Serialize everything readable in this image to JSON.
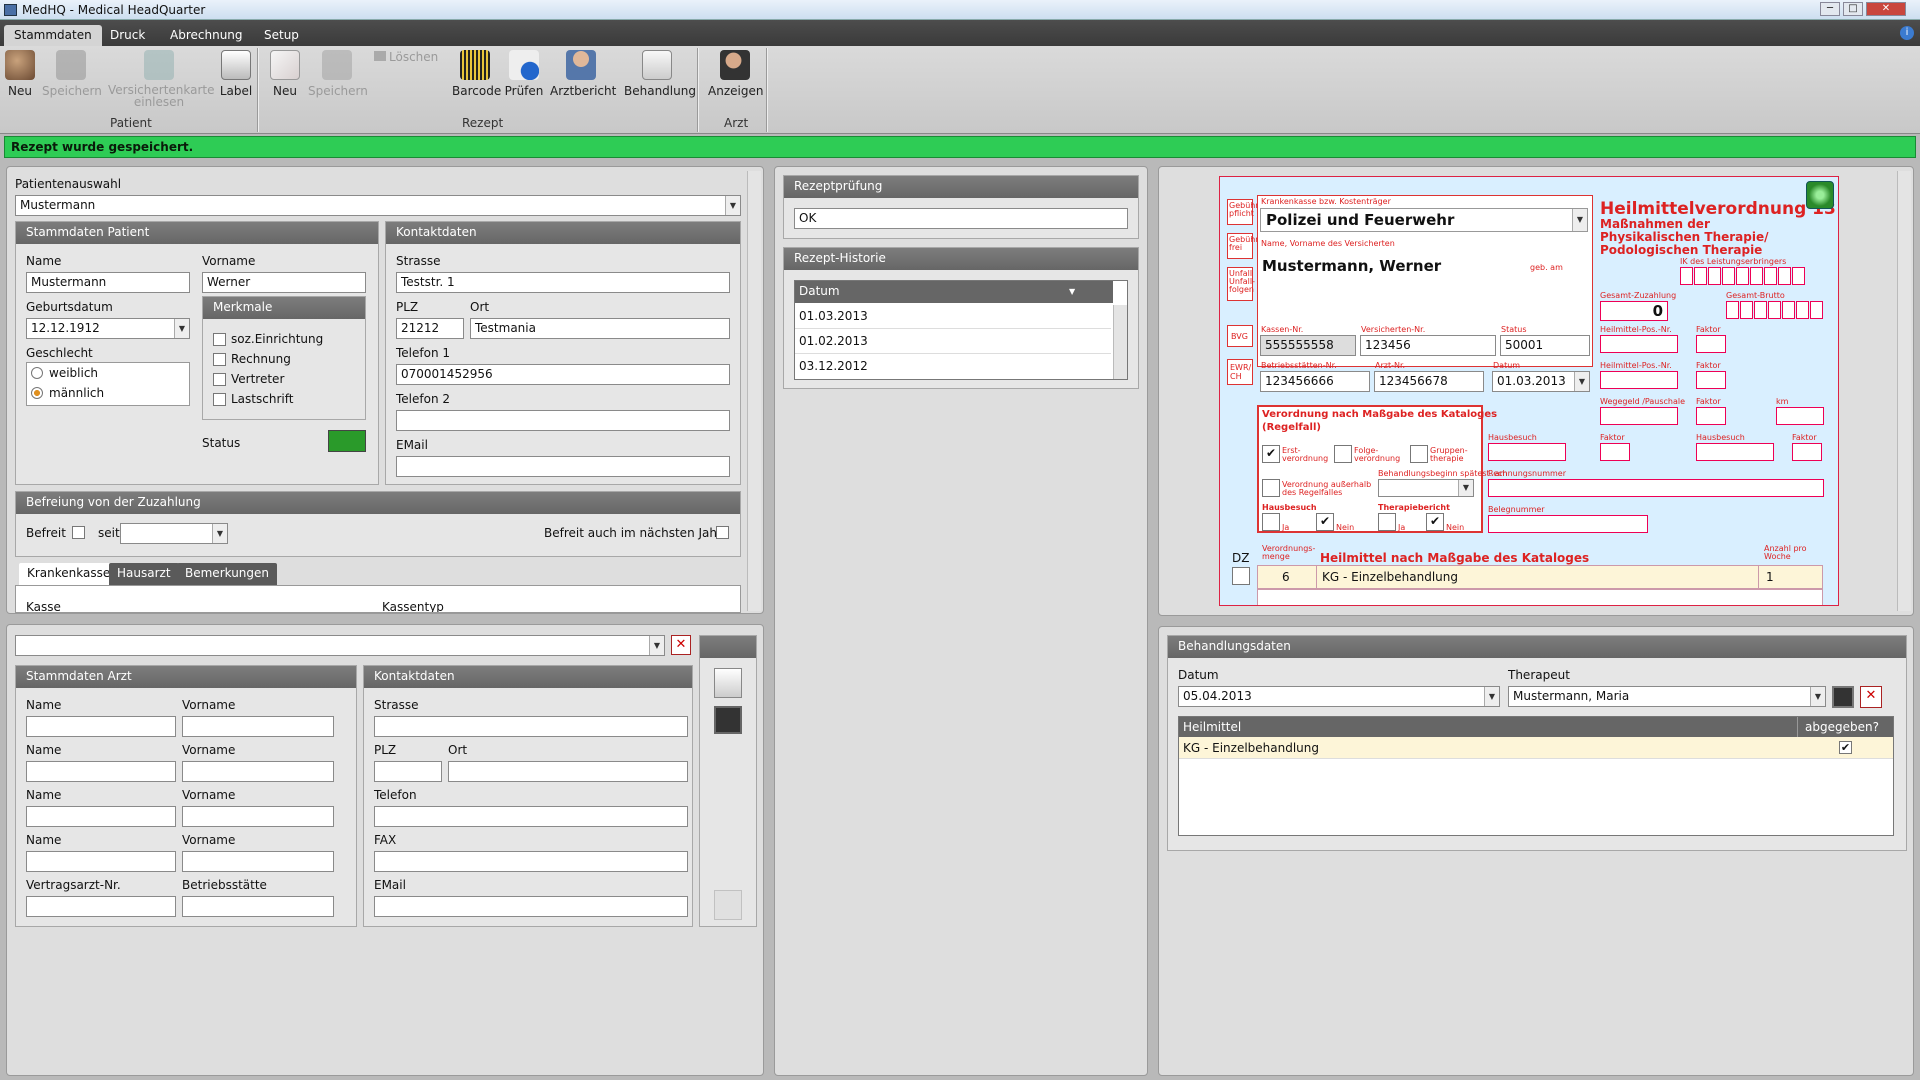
{
  "window": {
    "title": "MedHQ - Medical HeadQuarter",
    "min": "─",
    "max": "□",
    "close": "✕"
  },
  "ribbon": {
    "tabs": [
      "Stammdaten",
      "Druck",
      "Abrechnung",
      "Setup"
    ],
    "patient": {
      "neu": "Neu",
      "speichern": "Speichern",
      "karte": "Versichertenkarte einlesen",
      "label": "Label",
      "group": "Patient"
    },
    "rezept": {
      "neu": "Neu",
      "speichern": "Speichern",
      "loeschen": "Löschen",
      "barcode": "Barcode",
      "pruefen": "Prüfen",
      "arztbericht": "Arztbericht",
      "behandlung": "Behandlung",
      "group": "Rezept"
    },
    "arzt": {
      "anzeigen": "Anzeigen",
      "group": "Arzt"
    }
  },
  "status_message": "Rezept wurde gespeichert.",
  "patient": {
    "selection_label": "Patientenauswahl",
    "selection_value": "Mustermann",
    "stamm_header": "Stammdaten Patient",
    "name_label": "Name",
    "name": "Mustermann",
    "vorname_label": "Vorname",
    "vorname": "Werner",
    "geburtsdatum_label": "Geburtsdatum",
    "geburtsdatum": "12.12.1912",
    "geschlecht_label": "Geschlecht",
    "weiblich": "weiblich",
    "maennlich": "männlich",
    "merkmale_header": "Merkmale",
    "merkmale": [
      "soz.Einrichtung",
      "Rechnung",
      "Vertreter",
      "Lastschrift"
    ],
    "status_label": "Status",
    "status_color": "#2a9a2a",
    "kontakt_header": "Kontaktdaten",
    "strasse_label": "Strasse",
    "strasse": "Teststr. 1",
    "plz_label": "PLZ",
    "plz": "21212",
    "ort_label": "Ort",
    "ort": "Testmania",
    "tel1_label": "Telefon 1",
    "tel1": "070001452956",
    "tel2_label": "Telefon 2",
    "email_label": "EMail",
    "befreiung_header": "Befreiung von der Zuzahlung",
    "befreit_label": "Befreit",
    "seit_label": "seit",
    "naechstes_label": "Befreit auch im nächsten Jahr",
    "tabs": [
      "Krankenkasse",
      "Hausarzt",
      "Bemerkungen"
    ],
    "kasse_label": "Kasse",
    "kassentyp_label": "Kassentyp"
  },
  "arzt": {
    "stamm_header": "Stammdaten Arzt",
    "kontakt_header": "Kontaktdaten",
    "name_label": "Name",
    "vorname_label": "Vorname",
    "vertragsarzt_label": "Vertragsarzt-Nr.",
    "betriebsstaette_label": "Betriebsstätte",
    "strasse_label": "Strasse",
    "plz_label": "PLZ",
    "ort_label": "Ort",
    "telefon_label": "Telefon",
    "fax_label": "FAX",
    "email_label": "EMail"
  },
  "rezeptpruefung": {
    "header": "Rezeptprüfung",
    "value": "OK"
  },
  "historie": {
    "header": "Rezept-Historie",
    "col": "Datum",
    "rows": [
      "01.03.2013",
      "01.02.2013",
      "03.12.2012"
    ]
  },
  "form": {
    "title": "Heilmittelverordnung 13",
    "sub1": "Maßnahmen der",
    "sub2": "Physikalischen Therapie/",
    "sub3": "Podologischen Therapie",
    "kasse_label": "Krankenkasse bzw. Kostenträger",
    "kasse": "Polizei und Feuerwehr",
    "name_label": "Name, Vorname des Versicherten",
    "name": "Mustermann, Werner",
    "geb": "geb. am",
    "kassennr_label": "Kassen-Nr.",
    "kassennr": "555555558",
    "versnr_label": "Versicherten-Nr.",
    "versnr": "123456",
    "status_label": "Status",
    "status": "50001",
    "bsnr_label": "Betriebsstätten-Nr.",
    "bsnr": "123456666",
    "arztnr_label": "Arzt-Nr.",
    "arztnr": "123456678",
    "datum_label": "Datum",
    "datum": "01.03.2013",
    "side": [
      "Gebühr pflicht",
      "Gebühr frei",
      "Unfall Unfall-folgen",
      "BVG",
      "EWR/ CH"
    ],
    "ik_label": "IK des Leistungserbringers",
    "gz_label": "Gesamt-Zuzahlung",
    "gz": "0",
    "gb_label": "Gesamt-Brutto",
    "hpn_label": "Heilmittel-Pos.-Nr.",
    "faktor_label": "Faktor",
    "wegegeld_label": "Wegegeld /Pauschale",
    "km_label": "km",
    "hausbesuch_label": "Hausbesuch",
    "rechnung_label": "Rechnungsnummer",
    "beleg_label": "Belegnummer",
    "verordnung_header1": "Verordnung nach Maßgabe des Kataloges",
    "verordnung_header2": "(Regelfall)",
    "erst": "Erst- verordnung",
    "folge": "Folge- verordnung",
    "gruppe": "Gruppen- therapie",
    "beginn": "Behandlungsbeginn spätest. am",
    "ausserhalb": "Verordnung außerhalb des Regelfalles",
    "hausbesuch": "Hausbesuch",
    "therapiebericht": "Therapiebericht",
    "ja": "Ja",
    "nein": "Nein",
    "dz": "DZ",
    "vm_label": "Verordnungs- menge",
    "heilmittel_header": "Heilmittel nach Maßgabe des Kataloges",
    "anzahl_label": "Anzahl pro Woche",
    "menge": "6",
    "heilmittel": "KG - Einzelbehandlung",
    "anzahl": "1"
  },
  "behandlung": {
    "header": "Behandlungsdaten",
    "datum_label": "Datum",
    "datum": "05.04.2013",
    "therapeut_label": "Therapeut",
    "therapeut": "Mustermann, Maria",
    "col1": "Heilmittel",
    "col2": "abgegeben?",
    "row": "KG - Einzelbehandlung"
  }
}
